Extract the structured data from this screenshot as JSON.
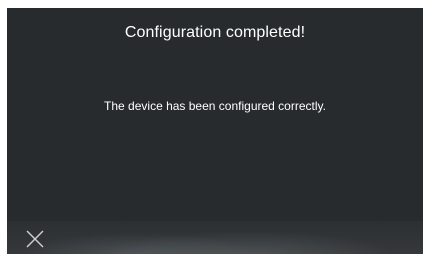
{
  "dialog": {
    "title": "Configuration completed!",
    "message": "The device has been configured correctly."
  },
  "bottom_bar": {
    "close_icon": "close-icon"
  },
  "colors": {
    "background": "#272b2e",
    "text": "#ffffff",
    "icon": "#d0d0d0"
  }
}
